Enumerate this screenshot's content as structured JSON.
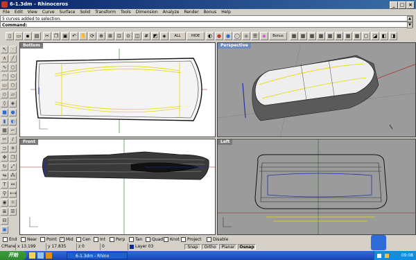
{
  "window": {
    "title": "6-1.3dm - Rhinoceros"
  },
  "menu": [
    "File",
    "Edit",
    "View",
    "Curve",
    "Surface",
    "Solid",
    "Transform",
    "Tools",
    "Dimension",
    "Analyze",
    "Render",
    "Bonus",
    "Help"
  ],
  "command": {
    "history": "5 curves added to selection.",
    "prompt": "Command:"
  },
  "toolbar": {
    "all_label": "ALL",
    "hide_label": "HIDE",
    "bonus_label": "Bonus"
  },
  "viewports": {
    "top_left": "Bottom",
    "top_right": "Perspective",
    "bottom_left": "Front",
    "bottom_right": "Left"
  },
  "osnap": [
    "End",
    "Near",
    "Point",
    "Mid",
    "Cen",
    "Int",
    "Perp",
    "Tan",
    "Quad",
    "Knot",
    "Project",
    "Disable"
  ],
  "osnap_checked": [
    "Mid"
  ],
  "status": {
    "cplane": "CPlane",
    "x": "x 13.199",
    "y": "y 17.835",
    "z": "z 0",
    "extra": "0",
    "layer": "Layer 03",
    "snap": "Snap",
    "ortho": "Ortho",
    "planar": "Planar",
    "osnap": "Osnap"
  },
  "taskbar": {
    "start": "开始",
    "item": "6-1.3dm - Rhino",
    "time": "09:08"
  },
  "colors": {
    "viewport_active": "#6e8cc0",
    "viewport_inactive": "#8a8a8a",
    "layer": "#0a2a9a",
    "curve_yellow": "#e8d800"
  }
}
